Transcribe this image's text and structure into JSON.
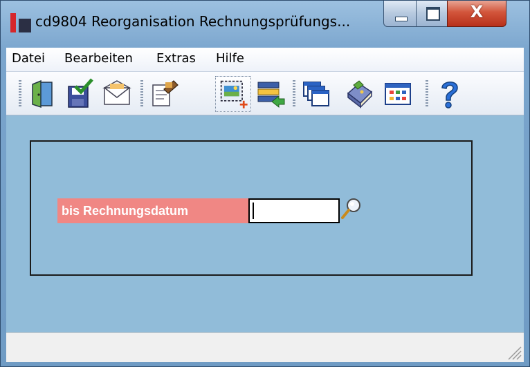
{
  "window": {
    "title": "cd9804 Reorganisation Rechnungsprüfungs...",
    "close_symbol": "X"
  },
  "menu": [
    "Datei",
    "Bearbeiten",
    "Extras",
    "Hilfe"
  ],
  "toolbar": [
    {
      "icon": "exit-door-icon"
    },
    {
      "icon": "save-check-icon"
    },
    {
      "icon": "envelope-icon"
    },
    {
      "icon": "edit-document-icon"
    },
    {
      "icon": "new-selection-icon",
      "active": true
    },
    {
      "icon": "import-list-icon"
    },
    {
      "icon": "windows-stack-icon"
    },
    {
      "icon": "book-icon"
    },
    {
      "icon": "table-grid-icon"
    },
    {
      "icon": "help-icon"
    }
  ],
  "form": {
    "field_label": "bis Rechnungsdatum",
    "field_value": "",
    "lookup_icon": "magnifier-icon"
  },
  "colors": {
    "client_bg": "#91bcd9",
    "label_bg": "#f08784",
    "close_button": "#c94a32"
  }
}
